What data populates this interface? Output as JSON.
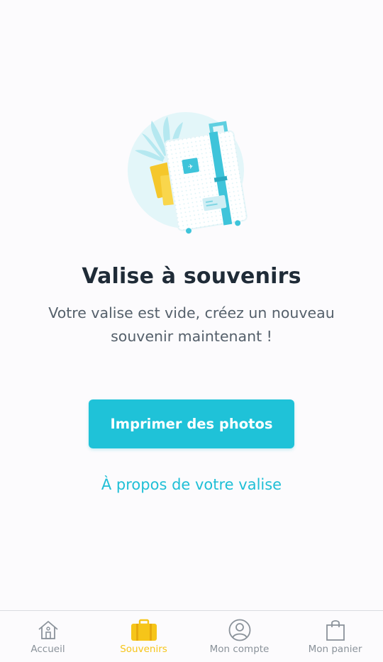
{
  "empty_state": {
    "title": "Valise à souvenirs",
    "message_line1": "Votre valise est vide, créez un nouveau",
    "message_line2": "souvenir maintenant !",
    "primary_button": "Imprimer des photos",
    "secondary_link": "À propos de votre valise",
    "illustration_icon": "suitcase-illustration"
  },
  "tabbar": {
    "tabs": [
      {
        "label": "Accueil",
        "icon": "home-icon",
        "active": false
      },
      {
        "label": "Souvenirs",
        "icon": "suitcase-icon",
        "active": true
      },
      {
        "label": "Mon compte",
        "icon": "user-icon",
        "active": false
      },
      {
        "label": "Mon panier",
        "icon": "bag-icon",
        "active": false
      }
    ]
  },
  "colors": {
    "accent": "#1fc2d8",
    "active_tab": "#f6c519",
    "inactive_tab": "#8a929a",
    "title": "#1f2b37"
  }
}
